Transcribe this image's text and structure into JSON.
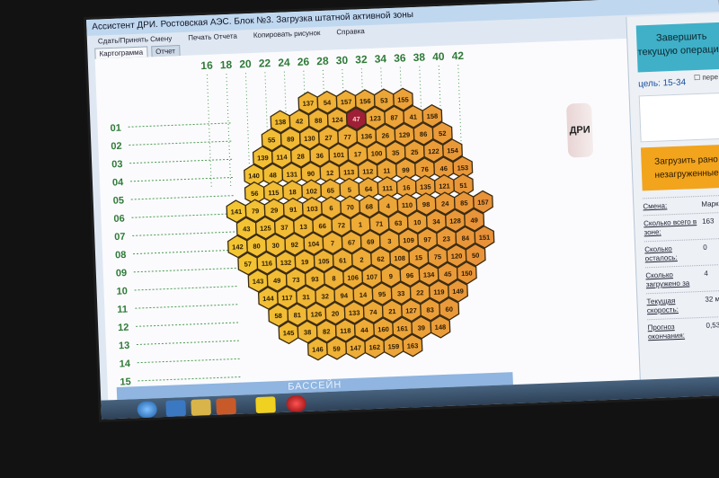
{
  "window": {
    "title": "Ассистент ДРИ. Ростовская АЭС. Блок №3. Загрузка штатной активной зоны"
  },
  "menu": [
    "Сдать/Принять Смену",
    "Печать Отчета",
    "Копировать рисунок",
    "Справка"
  ],
  "tabs": [
    "Картограмма",
    "Отчет"
  ],
  "columns": [
    "16",
    "18",
    "20",
    "22",
    "24",
    "26",
    "28",
    "30",
    "32",
    "34",
    "36",
    "38",
    "40",
    "42"
  ],
  "rows": [
    "01",
    "02",
    "03",
    "04",
    "05",
    "06",
    "07",
    "08",
    "09",
    "10",
    "11",
    "12",
    "13",
    "14",
    "15"
  ],
  "hex_rows": [
    [
      "137",
      "54",
      "157",
      "156",
      "53",
      "155"
    ],
    [
      "138",
      "42",
      "88",
      "124",
      "47",
      "123",
      "87",
      "41",
      "158"
    ],
    [
      "55",
      "89",
      "130",
      "27",
      "77",
      "136",
      "26",
      "129",
      "86",
      "52"
    ],
    [
      "139",
      "114",
      "28",
      "36",
      "101",
      "17",
      "100",
      "35",
      "25",
      "122",
      "154"
    ],
    [
      "140",
      "48",
      "131",
      "90",
      "12",
      "113",
      "112",
      "11",
      "99",
      "76",
      "46",
      "153"
    ],
    [
      "56",
      "115",
      "18",
      "102",
      "65",
      "5",
      "64",
      "111",
      "16",
      "135",
      "121",
      "51"
    ],
    [
      "141",
      "79",
      "29",
      "91",
      "103",
      "6",
      "70",
      "68",
      "4",
      "110",
      "98",
      "24",
      "85",
      "157"
    ],
    [
      "43",
      "125",
      "37",
      "13",
      "66",
      "72",
      "1",
      "71",
      "63",
      "10",
      "34",
      "128",
      "49"
    ],
    [
      "142",
      "80",
      "30",
      "92",
      "104",
      "7",
      "67",
      "69",
      "3",
      "109",
      "97",
      "23",
      "84",
      "151"
    ],
    [
      "57",
      "116",
      "132",
      "19",
      "105",
      "61",
      "2",
      "62",
      "108",
      "15",
      "75",
      "120",
      "50"
    ],
    [
      "143",
      "49",
      "73",
      "93",
      "8",
      "106",
      "107",
      "9",
      "96",
      "134",
      "45",
      "150"
    ],
    [
      "144",
      "117",
      "31",
      "32",
      "94",
      "14",
      "95",
      "33",
      "22",
      "119",
      "149"
    ],
    [
      "58",
      "81",
      "126",
      "20",
      "133",
      "74",
      "21",
      "127",
      "83",
      "60"
    ],
    [
      "145",
      "38",
      "82",
      "118",
      "44",
      "160",
      "161",
      "39",
      "148"
    ],
    [
      "146",
      "59",
      "147",
      "162",
      "159",
      "163"
    ]
  ],
  "highlight_cell": "47",
  "pool_label": "БАССЕЙН",
  "dri_button": "ДРИ",
  "finish_button": "Завершить текущую операцию",
  "target_label": "цель: 15-34",
  "checkbox_label": "пере",
  "load_button": "Загрузить рано незагруженные",
  "stats": [
    {
      "label": "Смена:",
      "value": "Марк"
    },
    {
      "label": "Сколько всего в зоне:",
      "value": "163"
    },
    {
      "label": "Сколько осталось:",
      "value": "0"
    },
    {
      "label": "Сколько загружено за",
      "value": "4"
    },
    {
      "label": "Текущая скорость:",
      "value": "32 ми"
    },
    {
      "label": "Прогноз окончания:",
      "value": "0,53 ч"
    }
  ],
  "colors": {
    "hex_fill_left": "#f1c232",
    "hex_fill_right": "#e8913a",
    "hex_highlight": "#9e1f36",
    "accent": "#3fb0c8"
  }
}
